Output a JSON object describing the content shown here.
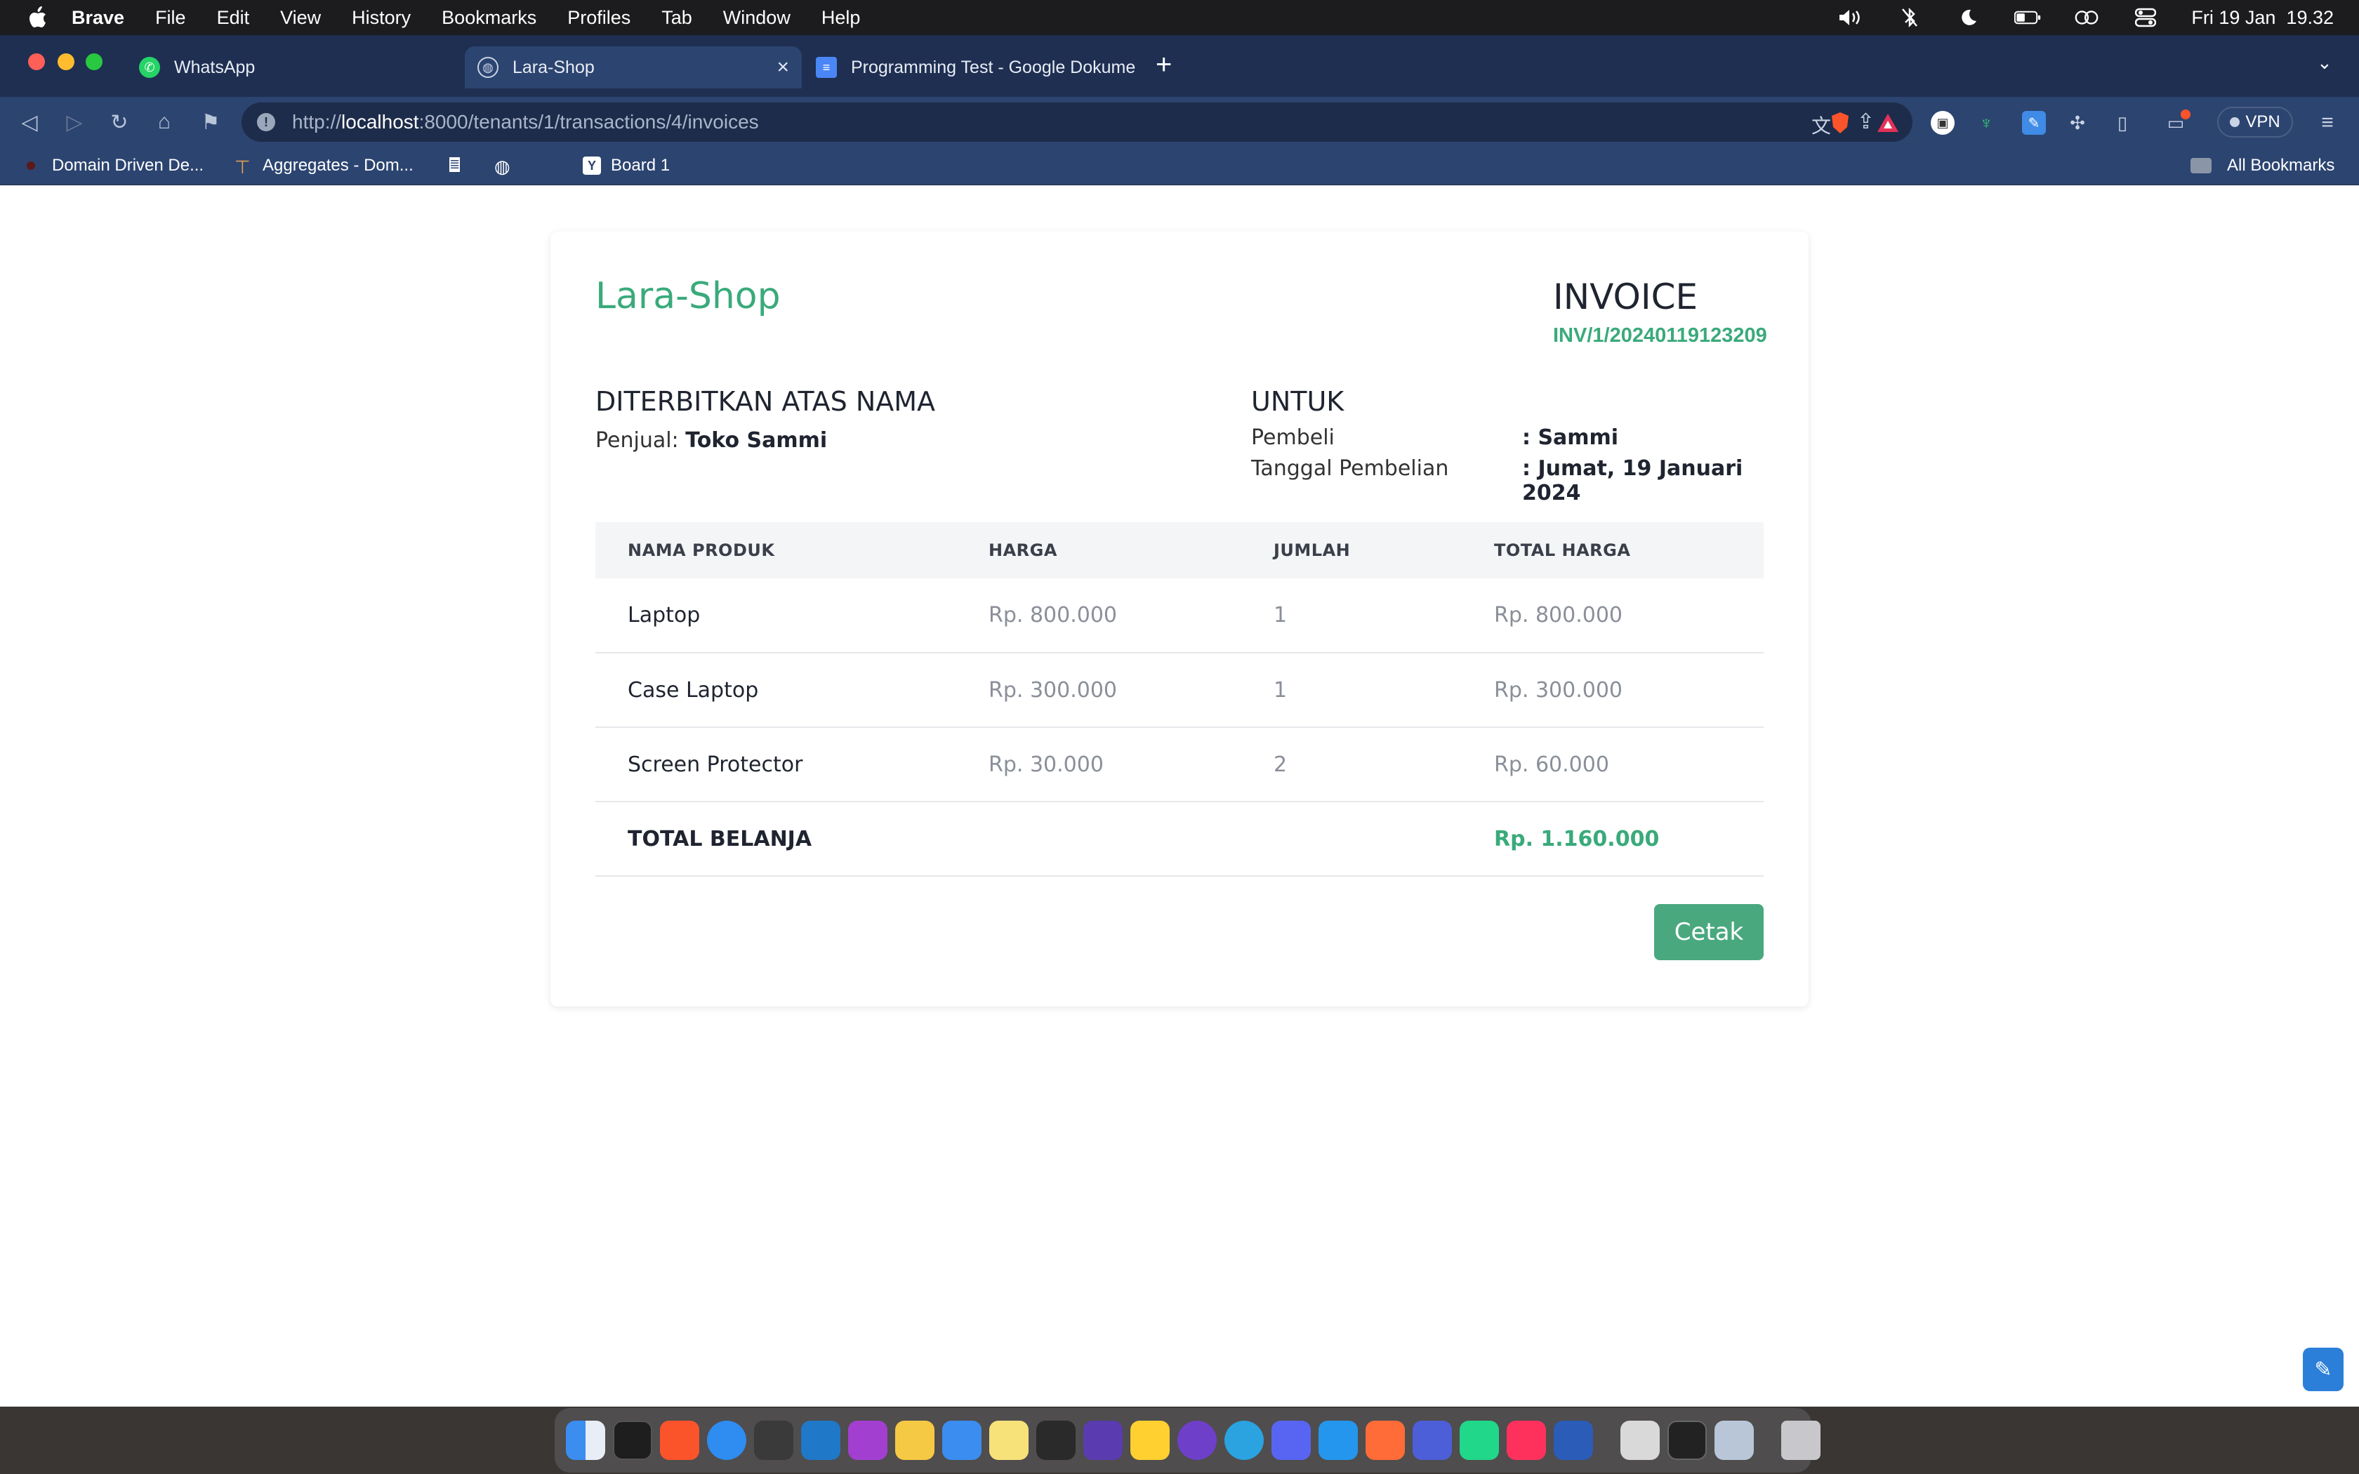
{
  "menubar": {
    "app_name": "Brave",
    "items": [
      "File",
      "Edit",
      "View",
      "History",
      "Bookmarks",
      "Profiles",
      "Tab",
      "Window",
      "Help"
    ],
    "datetime": "Fri 19 Jan  19.32"
  },
  "tabs": [
    {
      "label": "WhatsApp",
      "active": false
    },
    {
      "label": "Lara-Shop",
      "active": true
    },
    {
      "label": "Programming Test - Google Dokume",
      "active": false
    }
  ],
  "address_bar": {
    "url_prefix": "http://",
    "url_host": "localhost",
    "url_rest": ":8000/tenants/1/transactions/4/invoices"
  },
  "toolbar": {
    "vpn_label": "VPN"
  },
  "bookmarks": {
    "items": [
      "Domain Driven De...",
      "Aggregates - Dom...",
      "Board 1"
    ],
    "all_label": "All Bookmarks"
  },
  "invoice": {
    "brand": "Lara-Shop",
    "title": "INVOICE",
    "number": "INV/1/20240119123209",
    "issued_by_heading": "DITERBITKAN ATAS NAMA",
    "seller_label": "Penjual:",
    "seller_name": "Toko Sammi",
    "for_heading": "UNTUK",
    "buyer_label": "Pembeli",
    "buyer_value": ": Sammi",
    "date_label": "Tanggal Pembelian",
    "date_value": ": Jumat, 19 Januari 2024",
    "columns": [
      "NAMA PRODUK",
      "HARGA",
      "JUMLAH",
      "TOTAL HARGA"
    ],
    "rows": [
      {
        "name": "Laptop",
        "price": "Rp. 800.000",
        "qty": "1",
        "total": "Rp. 800.000"
      },
      {
        "name": "Case Laptop",
        "price": "Rp. 300.000",
        "qty": "1",
        "total": "Rp. 300.000"
      },
      {
        "name": "Screen Protector",
        "price": "Rp. 30.000",
        "qty": "2",
        "total": "Rp. 60.000"
      }
    ],
    "grand_total_label": "TOTAL BELANJA",
    "grand_total_value": "Rp. 1.160.000",
    "print_button": "Cetak"
  },
  "colors": {
    "accent": "#3aaa7b",
    "button": "#4aa87f",
    "chrome": "#2c4470"
  }
}
